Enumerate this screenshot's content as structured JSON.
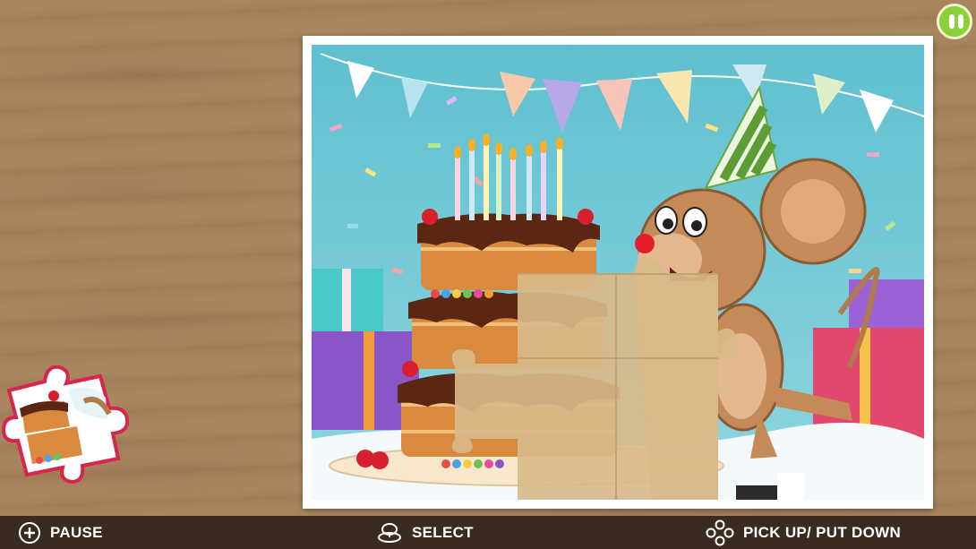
{
  "hud": {
    "pause_icon": "pause-icon",
    "button_color": "#8bd03a"
  },
  "puzzle": {
    "image_subject": "party-mouse-cake",
    "empty_slot_color": "#d9b98a"
  },
  "controls": {
    "pause": {
      "icon": "plus-circle-icon",
      "label": "PAUSE"
    },
    "select": {
      "icon": "stick-icon",
      "label": "SELECT"
    },
    "pickup": {
      "icon": "dpad-buttons-icon",
      "label": "PICK UP/ PUT DOWN"
    }
  },
  "colors": {
    "wood": "#a98660",
    "bar": "#3a2b20",
    "frame": "#ffffff",
    "sky": "#6fc7d4",
    "piece_border": "#d8254d"
  }
}
